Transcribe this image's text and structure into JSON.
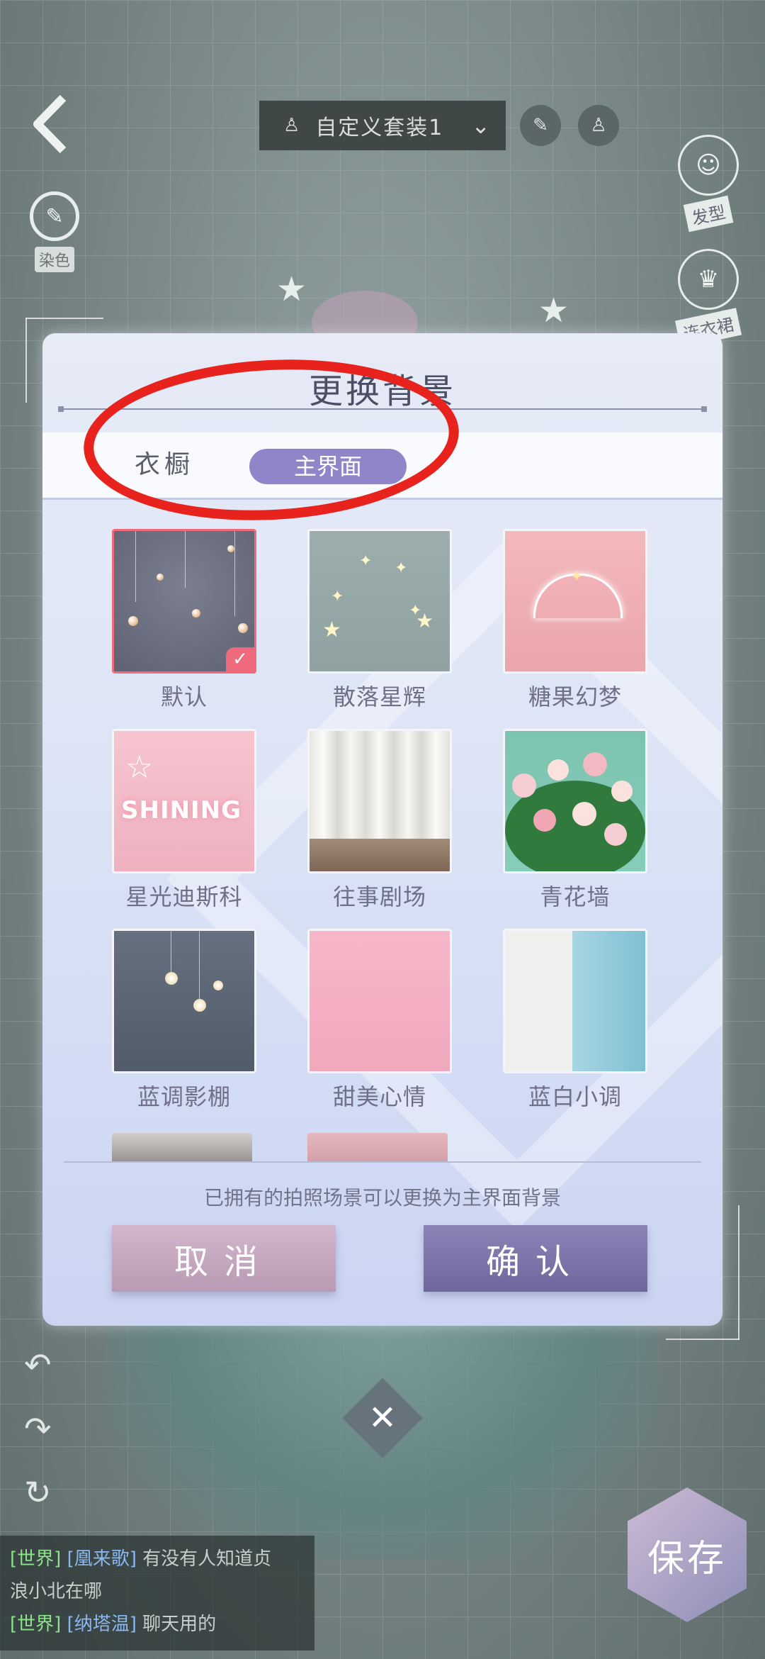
{
  "topbar": {
    "outfit_selector_label": "自定义套装1",
    "dye_label": "染色"
  },
  "right_side": {
    "hairstyle_label": "发型",
    "dress_label": "连衣裙"
  },
  "dialog": {
    "title": "更换背景",
    "tabs": [
      {
        "label": "衣橱",
        "active": false
      },
      {
        "label": "主界面",
        "active": true
      }
    ],
    "backgrounds": [
      {
        "name": "默认",
        "selected": true
      },
      {
        "name": "散落星辉",
        "selected": false
      },
      {
        "name": "糖果幻梦",
        "selected": false
      },
      {
        "name": "星光迪斯科",
        "selected": false,
        "thumb_text": "SHINING"
      },
      {
        "name": "往事剧场",
        "selected": false
      },
      {
        "name": "青花墙",
        "selected": false
      },
      {
        "name": "蓝调影棚",
        "selected": false
      },
      {
        "name": "甜美心情",
        "selected": false
      },
      {
        "name": "蓝白小调",
        "selected": false
      }
    ],
    "hint": "已拥有的拍照场景可以更换为主界面背景",
    "cancel_label": "取消",
    "confirm_label": "确认"
  },
  "close_symbol": "✕",
  "chat": {
    "lines": [
      {
        "channel": "[世界]",
        "name": "[凰来歌]",
        "text": "有没有人知道贞"
      },
      {
        "channel": "",
        "name": "",
        "text": "浪小北在哪"
      },
      {
        "channel": "[世界]",
        "name": "[纳塔温]",
        "text": "聊天用的"
      }
    ]
  },
  "save_label": "保存",
  "colors": {
    "annotation": "#e8231e",
    "active_tab": "#8e86c8",
    "selected_border": "#f06a7e",
    "cancel": "#c9abc3",
    "confirm": "#7c76ab"
  }
}
